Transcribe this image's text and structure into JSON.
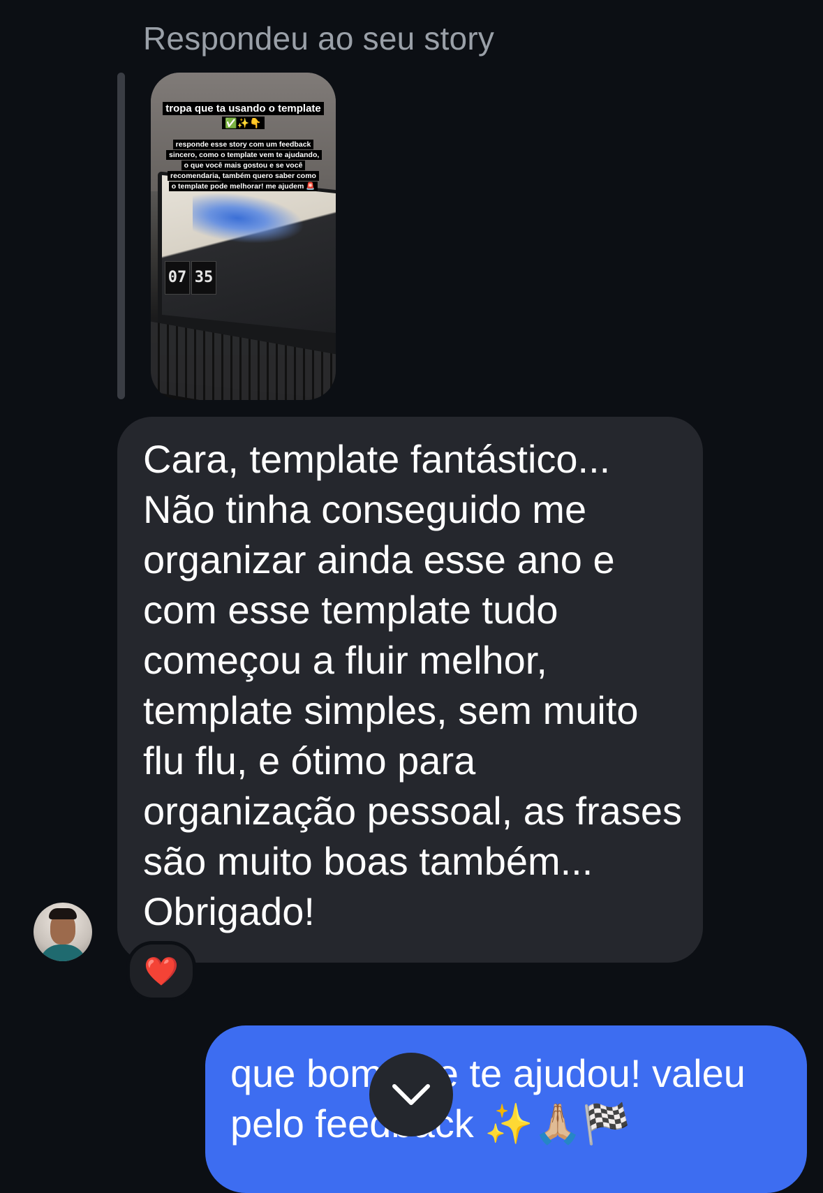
{
  "story_reply": {
    "caption": "Respondeu ao seu story",
    "story": {
      "title": "tropa que ta usando o template",
      "title_emoji": "✅✨👇",
      "body": "responde esse story com um feedback sincero, como o template vem te ajudando, o que você mais gostou e se você recomendaria, também quero saber como o template pode melhorar! me ajudem 🚨",
      "clock_hours": "07",
      "clock_minutes": "35"
    }
  },
  "received_message": {
    "text": "Cara, template fantástico... Não tinha conseguido me organizar ainda esse ano e com esse template tudo começou a fluir melhor, template simples, sem muito flu flu, e ótimo para organização pessoal, as frases são muito boas também... Obrigado!",
    "reaction": "❤️"
  },
  "sent_message": {
    "text": "que bom que te ajudou! valeu pelo feedback ✨🙏🏼🏁"
  },
  "colors": {
    "background": "#0c0f14",
    "received_bubble": "#25272d",
    "sent_bubble": "#3d6df1",
    "caption": "#9aa0a8"
  },
  "icons": {
    "scroll_down": "chevron-down-icon"
  }
}
